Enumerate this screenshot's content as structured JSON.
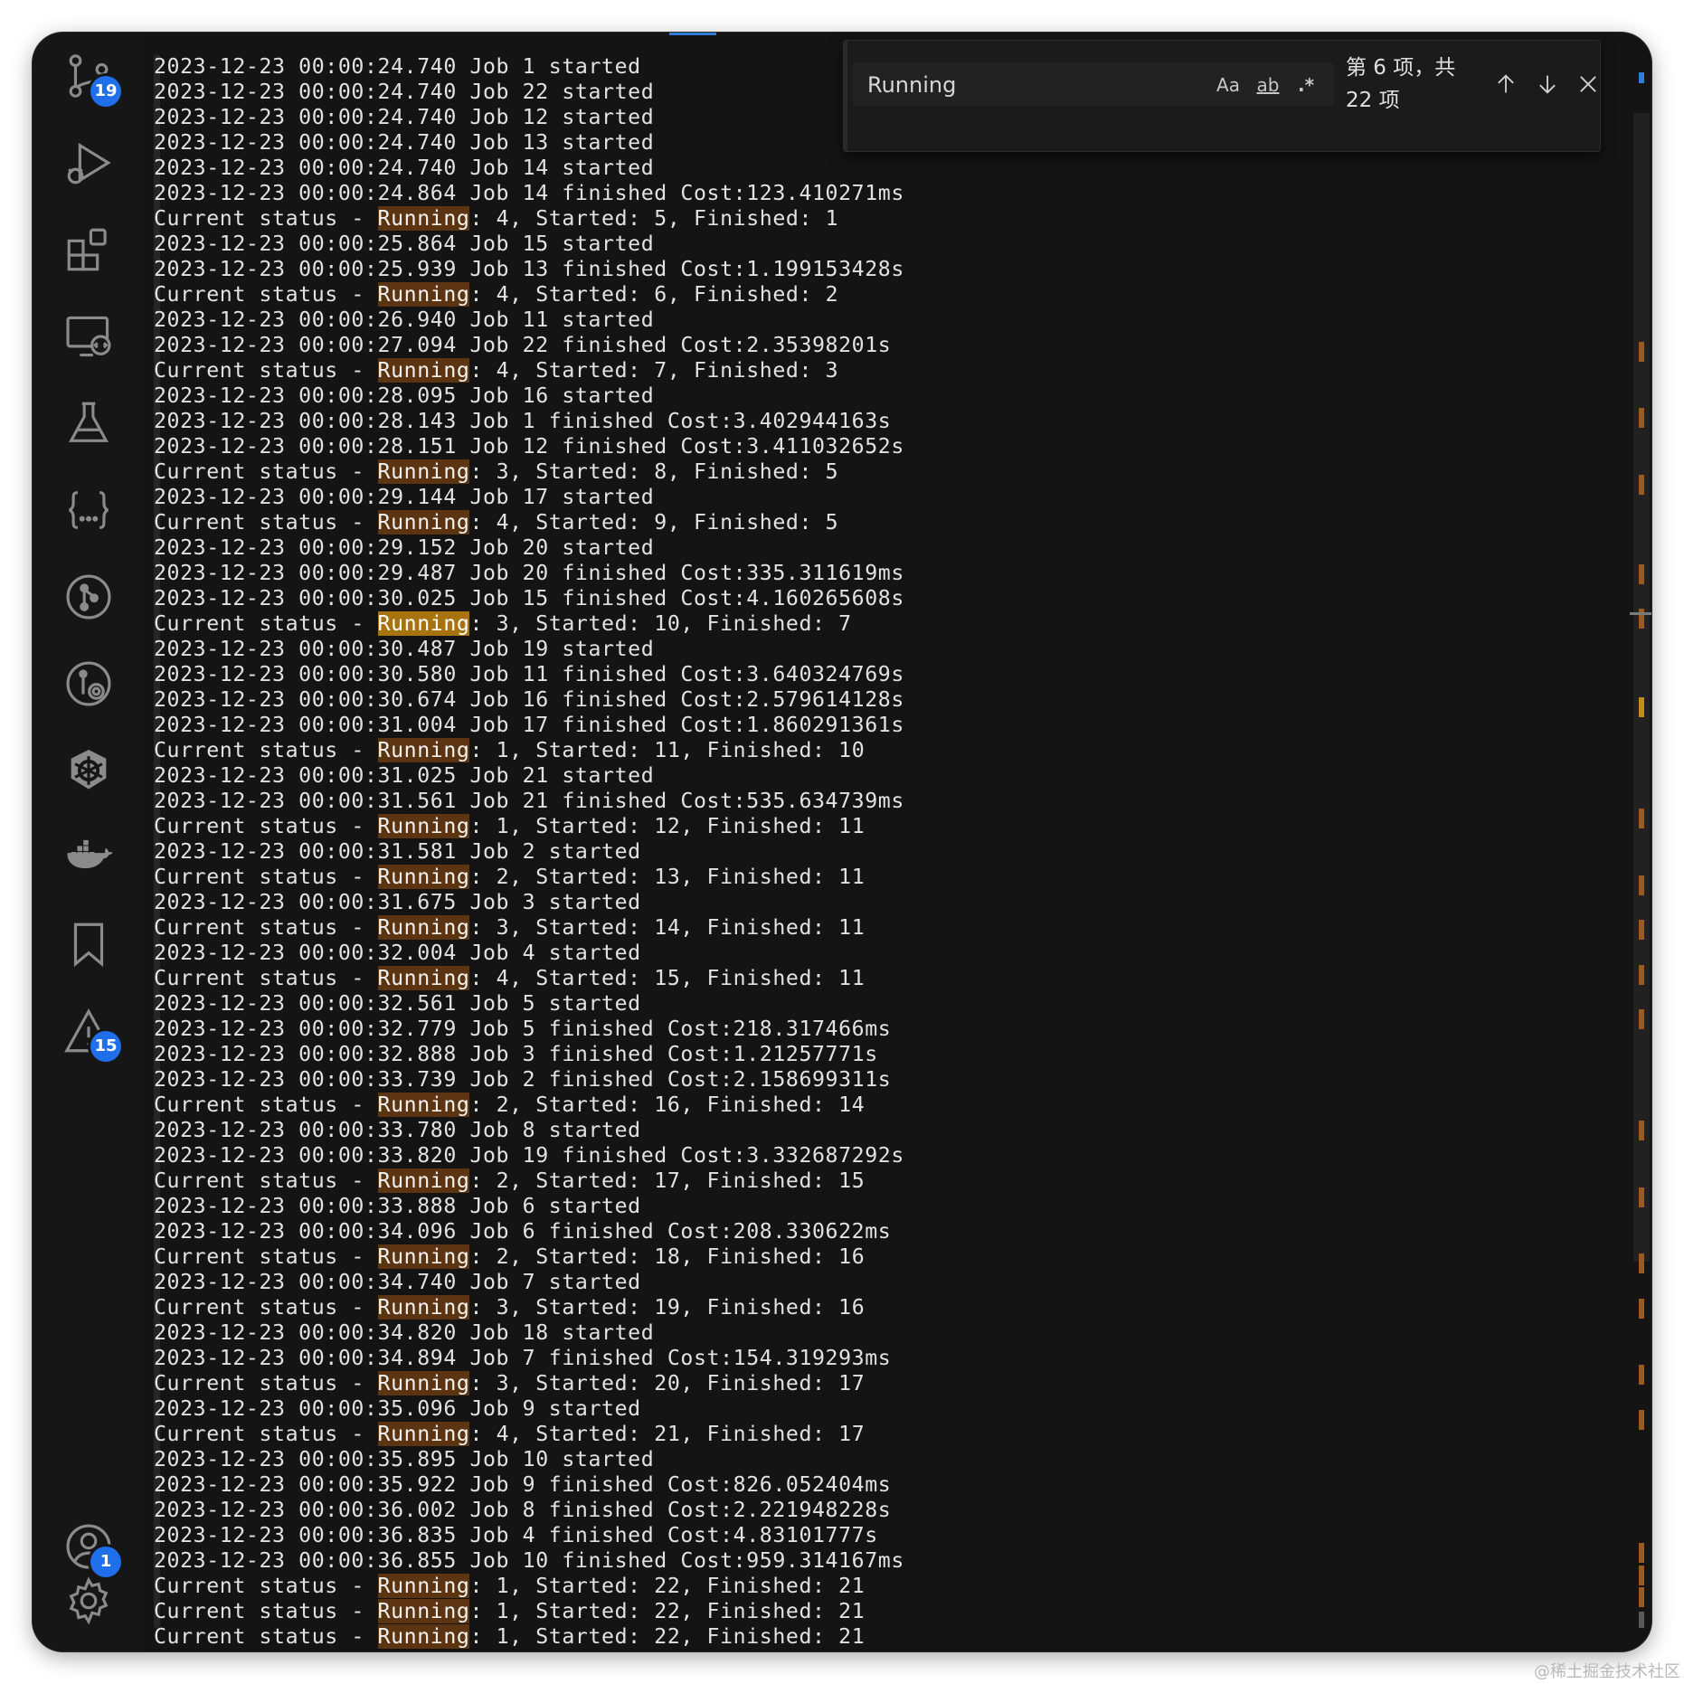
{
  "activity_bar": {
    "source_control_badge": "19",
    "problems_badge": "15",
    "accounts_badge": "1"
  },
  "find_widget": {
    "query": "Running",
    "match_case_label": "Aa",
    "whole_word_label": "ab",
    "regex_label": ".*",
    "match_count": "第 6 项，共 22 项",
    "current_match_index": 6,
    "total_matches": 22
  },
  "highlight_term": "Running",
  "log_lines": [
    "2023-12-23 00:00:24.740 Job 1 started",
    "2023-12-23 00:00:24.740 Job 22 started",
    "2023-12-23 00:00:24.740 Job 12 started",
    "2023-12-23 00:00:24.740 Job 13 started",
    "2023-12-23 00:00:24.740 Job 14 started",
    "2023-12-23 00:00:24.864 Job 14 finished Cost:123.410271ms",
    "Current status - Running: 4, Started: 5, Finished: 1",
    "2023-12-23 00:00:25.864 Job 15 started",
    "2023-12-23 00:00:25.939 Job 13 finished Cost:1.199153428s",
    "Current status - Running: 4, Started: 6, Finished: 2",
    "2023-12-23 00:00:26.940 Job 11 started",
    "2023-12-23 00:00:27.094 Job 22 finished Cost:2.35398201s",
    "Current status - Running: 4, Started: 7, Finished: 3",
    "2023-12-23 00:00:28.095 Job 16 started",
    "2023-12-23 00:00:28.143 Job 1 finished Cost:3.402944163s",
    "2023-12-23 00:00:28.151 Job 12 finished Cost:3.411032652s",
    "Current status - Running: 3, Started: 8, Finished: 5",
    "2023-12-23 00:00:29.144 Job 17 started",
    "Current status - Running: 4, Started: 9, Finished: 5",
    "2023-12-23 00:00:29.152 Job 20 started",
    "2023-12-23 00:00:29.487 Job 20 finished Cost:335.311619ms",
    "2023-12-23 00:00:30.025 Job 15 finished Cost:4.160265608s",
    "Current status - Running: 3, Started: 10, Finished: 7",
    "2023-12-23 00:00:30.487 Job 19 started",
    "2023-12-23 00:00:30.580 Job 11 finished Cost:3.640324769s",
    "2023-12-23 00:00:30.674 Job 16 finished Cost:2.579614128s",
    "2023-12-23 00:00:31.004 Job 17 finished Cost:1.860291361s",
    "Current status - Running: 1, Started: 11, Finished: 10",
    "2023-12-23 00:00:31.025 Job 21 started",
    "2023-12-23 00:00:31.561 Job 21 finished Cost:535.634739ms",
    "Current status - Running: 1, Started: 12, Finished: 11",
    "2023-12-23 00:00:31.581 Job 2 started",
    "Current status - Running: 2, Started: 13, Finished: 11",
    "2023-12-23 00:00:31.675 Job 3 started",
    "Current status - Running: 3, Started: 14, Finished: 11",
    "2023-12-23 00:00:32.004 Job 4 started",
    "Current status - Running: 4, Started: 15, Finished: 11",
    "2023-12-23 00:00:32.561 Job 5 started",
    "2023-12-23 00:00:32.779 Job 5 finished Cost:218.317466ms",
    "2023-12-23 00:00:32.888 Job 3 finished Cost:1.21257771s",
    "2023-12-23 00:00:33.739 Job 2 finished Cost:2.158699311s",
    "Current status - Running: 2, Started: 16, Finished: 14",
    "2023-12-23 00:00:33.780 Job 8 started",
    "2023-12-23 00:00:33.820 Job 19 finished Cost:3.332687292s",
    "Current status - Running: 2, Started: 17, Finished: 15",
    "2023-12-23 00:00:33.888 Job 6 started",
    "2023-12-23 00:00:34.096 Job 6 finished Cost:208.330622ms",
    "Current status - Running: 2, Started: 18, Finished: 16",
    "2023-12-23 00:00:34.740 Job 7 started",
    "Current status - Running: 3, Started: 19, Finished: 16",
    "2023-12-23 00:00:34.820 Job 18 started",
    "2023-12-23 00:00:34.894 Job 7 finished Cost:154.319293ms",
    "Current status - Running: 3, Started: 20, Finished: 17",
    "2023-12-23 00:00:35.096 Job 9 started",
    "Current status - Running: 4, Started: 21, Finished: 17",
    "2023-12-23 00:00:35.895 Job 10 started",
    "2023-12-23 00:00:35.922 Job 9 finished Cost:826.052404ms",
    "2023-12-23 00:00:36.002 Job 8 finished Cost:2.221948228s",
    "2023-12-23 00:00:36.835 Job 4 finished Cost:4.83101777s",
    "2023-12-23 00:00:36.855 Job 10 finished Cost:959.314167ms",
    "Current status - Running: 1, Started: 22, Finished: 21",
    "Current status - Running: 1, Started: 22, Finished: 21",
    "Current status - Running: 1, Started: 22, Finished: 21"
  ],
  "colors": {
    "background": "#141414",
    "text": "#e2e2e2",
    "match_highlight": "#5c3412",
    "current_match_highlight": "#a8720e",
    "badge": "#1f6feb"
  },
  "watermark": "@稀土掘金技术社区"
}
